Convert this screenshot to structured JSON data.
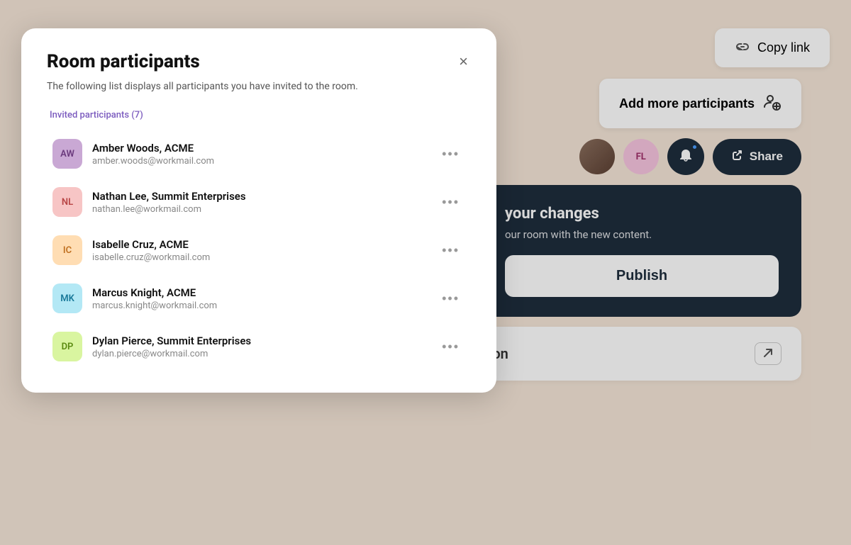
{
  "modal": {
    "title": "Room participants",
    "description": "The following list displays all participants you have invited to the room.",
    "close_label": "×",
    "section_label": "Invited participants (7)",
    "participants": [
      {
        "initials": "AW",
        "name": "Amber Woods, ACME",
        "email": "amber.woods@workmail.com",
        "color": "#c9a8d4",
        "text_color": "#6b3a7d"
      },
      {
        "initials": "NL",
        "name": "Nathan Lee, Summit Enterprises",
        "email": "nathan.lee@workmail.com",
        "color": "#f7c5c5",
        "text_color": "#b84545"
      },
      {
        "initials": "IC",
        "name": "Isabelle Cruz, ACME",
        "email": "isabelle.cruz@workmail.com",
        "color": "#ffddb3",
        "text_color": "#c07020"
      },
      {
        "initials": "MK",
        "name": "Marcus Knight, ACME",
        "email": "marcus.knight@workmail.com",
        "color": "#b3e8f5",
        "text_color": "#1a7a9a"
      },
      {
        "initials": "DP",
        "name": "Dylan Pierce, Summit Enterprises",
        "email": "dylan.pierce@workmail.com",
        "color": "#d9f5a0",
        "text_color": "#5a8a10"
      }
    ],
    "more_button_label": "•••"
  },
  "sidebar": {
    "copy_link_label": "Copy link",
    "add_participants_label": "Add more participants",
    "fl_initials": "FL",
    "fl_color": "#f7c5e0",
    "fl_text_color": "#a0306a",
    "share_label": "Share",
    "dark_card": {
      "title": "your changes",
      "description": "our room with the new content.",
      "publish_label": "Publish"
    },
    "conversation_label": "Conversation"
  },
  "icons": {
    "close": "×",
    "link": "⊕",
    "bell": "🔔",
    "share": "↗",
    "expand": "▶",
    "add_user": "⊕"
  }
}
